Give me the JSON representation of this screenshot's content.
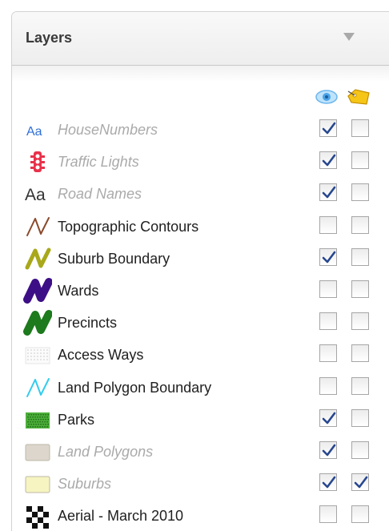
{
  "panel": {
    "title": "Layers"
  },
  "columns": {
    "visibility_icon": "eye-icon",
    "label_icon": "label-tag-icon"
  },
  "layers": [
    {
      "name": "HouseNumbers",
      "dim": true,
      "visible": true,
      "labeled": false,
      "symbol": "text-aa-blue",
      "color": "#2f6fd6"
    },
    {
      "name": "Traffic Lights",
      "dim": true,
      "visible": true,
      "labeled": false,
      "symbol": "traffic-light",
      "color": "#e8324a"
    },
    {
      "name": "Road Names",
      "dim": true,
      "visible": true,
      "labeled": false,
      "symbol": "text-aa-black",
      "color": "#333333"
    },
    {
      "name": "Topographic Contours",
      "dim": false,
      "visible": false,
      "labeled": false,
      "symbol": "line-zigzag",
      "color": "#8a4a2a"
    },
    {
      "name": "Suburb Boundary",
      "dim": false,
      "visible": true,
      "labeled": false,
      "symbol": "line-zigzag-thick",
      "color": "#a8a81a"
    },
    {
      "name": "Wards",
      "dim": false,
      "visible": false,
      "labeled": false,
      "symbol": "line-zigzag-heavy",
      "color": "#3d0f86"
    },
    {
      "name": "Precincts",
      "dim": false,
      "visible": false,
      "labeled": false,
      "symbol": "line-zigzag-heavy",
      "color": "#1d7a1d"
    },
    {
      "name": "Access Ways",
      "dim": false,
      "visible": false,
      "labeled": false,
      "symbol": "dotted-box",
      "color": "#c8c8c8"
    },
    {
      "name": "Land Polygon Boundary",
      "dim": false,
      "visible": false,
      "labeled": false,
      "symbol": "line-zigzag",
      "color": "#33ccee"
    },
    {
      "name": "Parks",
      "dim": false,
      "visible": true,
      "labeled": false,
      "symbol": "pattern-box",
      "color": "#4caf3a"
    },
    {
      "name": "Land Polygons",
      "dim": true,
      "visible": true,
      "labeled": false,
      "symbol": "filled-box",
      "color": "#ddd6cc"
    },
    {
      "name": "Suburbs",
      "dim": true,
      "visible": true,
      "labeled": true,
      "symbol": "filled-box",
      "color": "#f6f4c0"
    },
    {
      "name": "Aerial - March 2010",
      "dim": false,
      "visible": false,
      "labeled": false,
      "symbol": "checker-box",
      "color": "#111111"
    }
  ]
}
